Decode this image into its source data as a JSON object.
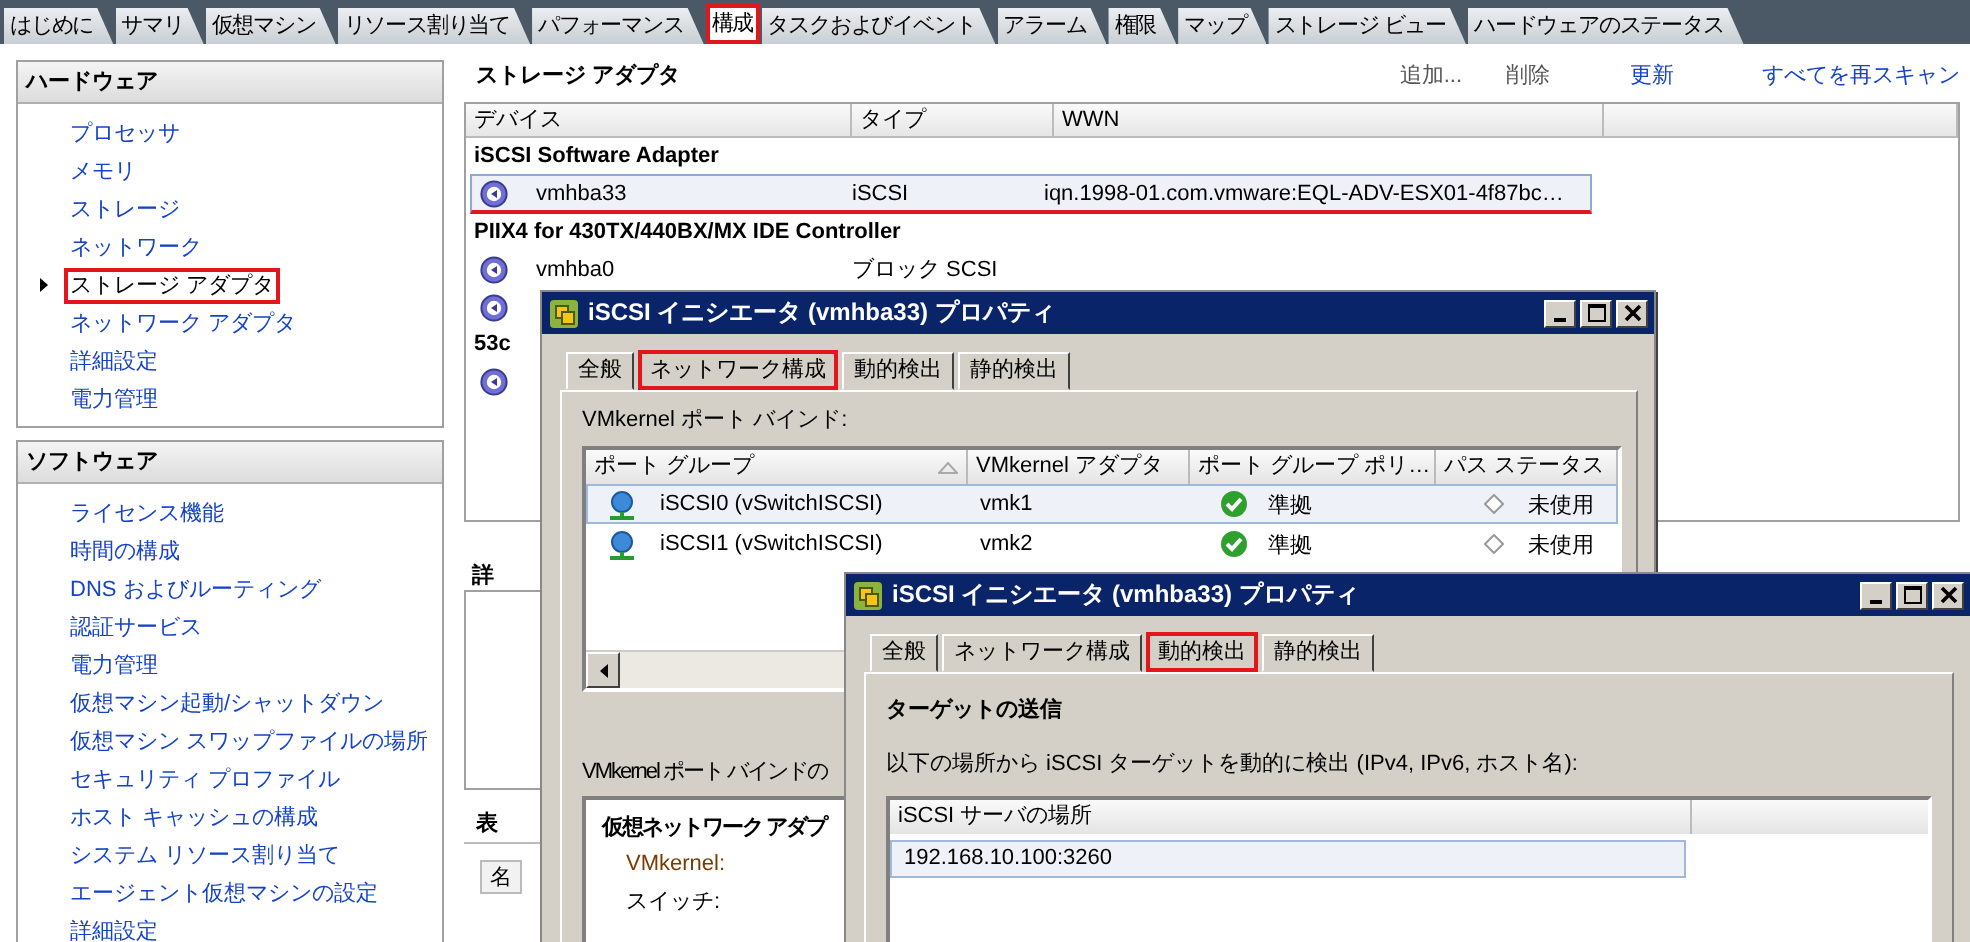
{
  "main_tabs": [
    {
      "label": "はじめに",
      "selected": false,
      "highlighted": false
    },
    {
      "label": "サマリ",
      "selected": false,
      "highlighted": false
    },
    {
      "label": "仮想マシン",
      "selected": false,
      "highlighted": false
    },
    {
      "label": "リソース割り当て",
      "selected": false,
      "highlighted": false
    },
    {
      "label": "パフォーマンス",
      "selected": false,
      "highlighted": false
    },
    {
      "label": "構成",
      "selected": true,
      "highlighted": true
    },
    {
      "label": "タスクおよびイベント",
      "selected": false,
      "highlighted": false
    },
    {
      "label": "アラーム",
      "selected": false,
      "highlighted": false
    },
    {
      "label": "権限",
      "selected": false,
      "highlighted": false
    },
    {
      "label": "マップ",
      "selected": false,
      "highlighted": false
    },
    {
      "label": "ストレージ ビュー",
      "selected": false,
      "highlighted": false
    },
    {
      "label": "ハードウェアのステータス",
      "selected": false,
      "highlighted": false
    }
  ],
  "sidebar": {
    "sections": [
      {
        "title": "ハードウェア",
        "items": [
          {
            "label": "プロセッサ",
            "selected": false,
            "highlighted": false
          },
          {
            "label": "メモリ",
            "selected": false,
            "highlighted": false
          },
          {
            "label": "ストレージ",
            "selected": false,
            "highlighted": false
          },
          {
            "label": "ネットワーク",
            "selected": false,
            "highlighted": false
          },
          {
            "label": "ストレージ アダプタ",
            "selected": true,
            "highlighted": true
          },
          {
            "label": "ネットワーク アダプタ",
            "selected": false,
            "highlighted": false
          },
          {
            "label": "詳細設定",
            "selected": false,
            "highlighted": false
          },
          {
            "label": "電力管理",
            "selected": false,
            "highlighted": false
          }
        ]
      },
      {
        "title": "ソフトウェア",
        "items": [
          {
            "label": "ライセンス機能",
            "selected": false,
            "highlighted": false
          },
          {
            "label": "時間の構成",
            "selected": false,
            "highlighted": false
          },
          {
            "label": "DNS およびルーティング",
            "selected": false,
            "highlighted": false
          },
          {
            "label": "認証サービス",
            "selected": false,
            "highlighted": false
          },
          {
            "label": "電力管理",
            "selected": false,
            "highlighted": false
          },
          {
            "label": "仮想マシン起動/シャットダウン",
            "selected": false,
            "highlighted": false
          },
          {
            "label": "仮想マシン スワップファイルの場所",
            "selected": false,
            "highlighted": false
          },
          {
            "label": "セキュリティ プロファイル",
            "selected": false,
            "highlighted": false
          },
          {
            "label": "ホスト キャッシュの構成",
            "selected": false,
            "highlighted": false
          },
          {
            "label": "システム リソース割り当て",
            "selected": false,
            "highlighted": false
          },
          {
            "label": "エージェント仮想マシンの設定",
            "selected": false,
            "highlighted": false
          },
          {
            "label": "詳細設定",
            "selected": false,
            "highlighted": false
          }
        ]
      }
    ]
  },
  "content": {
    "title": "ストレージ アダプタ",
    "actions": [
      {
        "label": "追加...",
        "disabled": true
      },
      {
        "label": "削除",
        "disabled": true
      },
      {
        "label": "更新",
        "disabled": false
      },
      {
        "label": "すべてを再スキャン",
        "disabled": false
      }
    ],
    "adapter_table": {
      "columns": [
        "デバイス",
        "タイプ",
        "WWN"
      ],
      "groups": [
        {
          "name": "iSCSI Software Adapter",
          "rows": [
            {
              "device": "vmhba33",
              "type": "iSCSI",
              "wwn": "iqn.1998-01.com.vmware:EQL-ADV-ESX01-4f87bc…",
              "selected": true,
              "highlighted": true
            }
          ]
        },
        {
          "name": "PIIX4 for 430TX/440BX/MX IDE Controller",
          "rows": [
            {
              "device": "vmhba0",
              "type": "ブロック SCSI",
              "selected": false,
              "highlighted": false
            },
            {
              "selected": false,
              "highlighted": false
            }
          ]
        },
        {
          "name": "53c",
          "rows": [
            {
              "selected": false,
              "highlighted": false
            }
          ]
        }
      ]
    },
    "details": {
      "title": "詳",
      "view_label": "表",
      "column_label": "名"
    }
  },
  "dialogs": [
    {
      "kind": "network",
      "title": "iSCSI イニシエータ (vmhba33) プロパティ",
      "tabs": [
        {
          "label": "全般",
          "selected": false,
          "highlighted": false
        },
        {
          "label": "ネットワーク構成",
          "selected": true,
          "highlighted": true
        },
        {
          "label": "動的検出",
          "selected": false,
          "highlighted": false
        },
        {
          "label": "静的検出",
          "selected": false,
          "highlighted": false
        }
      ],
      "binding_label": "VMkernel ポート バインド:",
      "columns": [
        {
          "label": "ポート グループ",
          "sorted": true
        },
        {
          "label": "VMkernel アダプタ",
          "sorted": false
        },
        {
          "label": "ポート グループ ポリ…",
          "sorted": false
        },
        {
          "label": "パス ステータス",
          "sorted": false
        }
      ],
      "rows": [
        {
          "port_group": "iSCSI0 (vSwitchISCSI)",
          "adapter": "vmk1",
          "policy": "準拠",
          "path_status": "未使用",
          "selected": true
        },
        {
          "port_group": "iSCSI1 (vSwitchISCSI)",
          "adapter": "vmk2",
          "policy": "準拠",
          "path_status": "未使用",
          "selected": false
        }
      ],
      "details_label": "VMkernel ポート バインドの",
      "details_box": {
        "title": "仮想ネットワーク アダプ",
        "fields": [
          "VMkernel:",
          "スイッチ:"
        ]
      }
    },
    {
      "kind": "dynamic",
      "title": "iSCSI イニシエータ (vmhba33) プロパティ",
      "tabs": [
        {
          "label": "全般",
          "selected": false,
          "highlighted": false
        },
        {
          "label": "ネットワーク構成",
          "selected": false,
          "highlighted": false
        },
        {
          "label": "動的検出",
          "selected": true,
          "highlighted": true
        },
        {
          "label": "静的検出",
          "selected": false,
          "highlighted": false
        }
      ],
      "heading": "ターゲットの送信",
      "description": "以下の場所から iSCSI ターゲットを動的に検出 (IPv4, IPv6, ホスト名):",
      "column": "iSCSI サーバの場所",
      "rows": [
        {
          "location": "192.168.10.100:3260",
          "selected": true
        }
      ]
    }
  ]
}
